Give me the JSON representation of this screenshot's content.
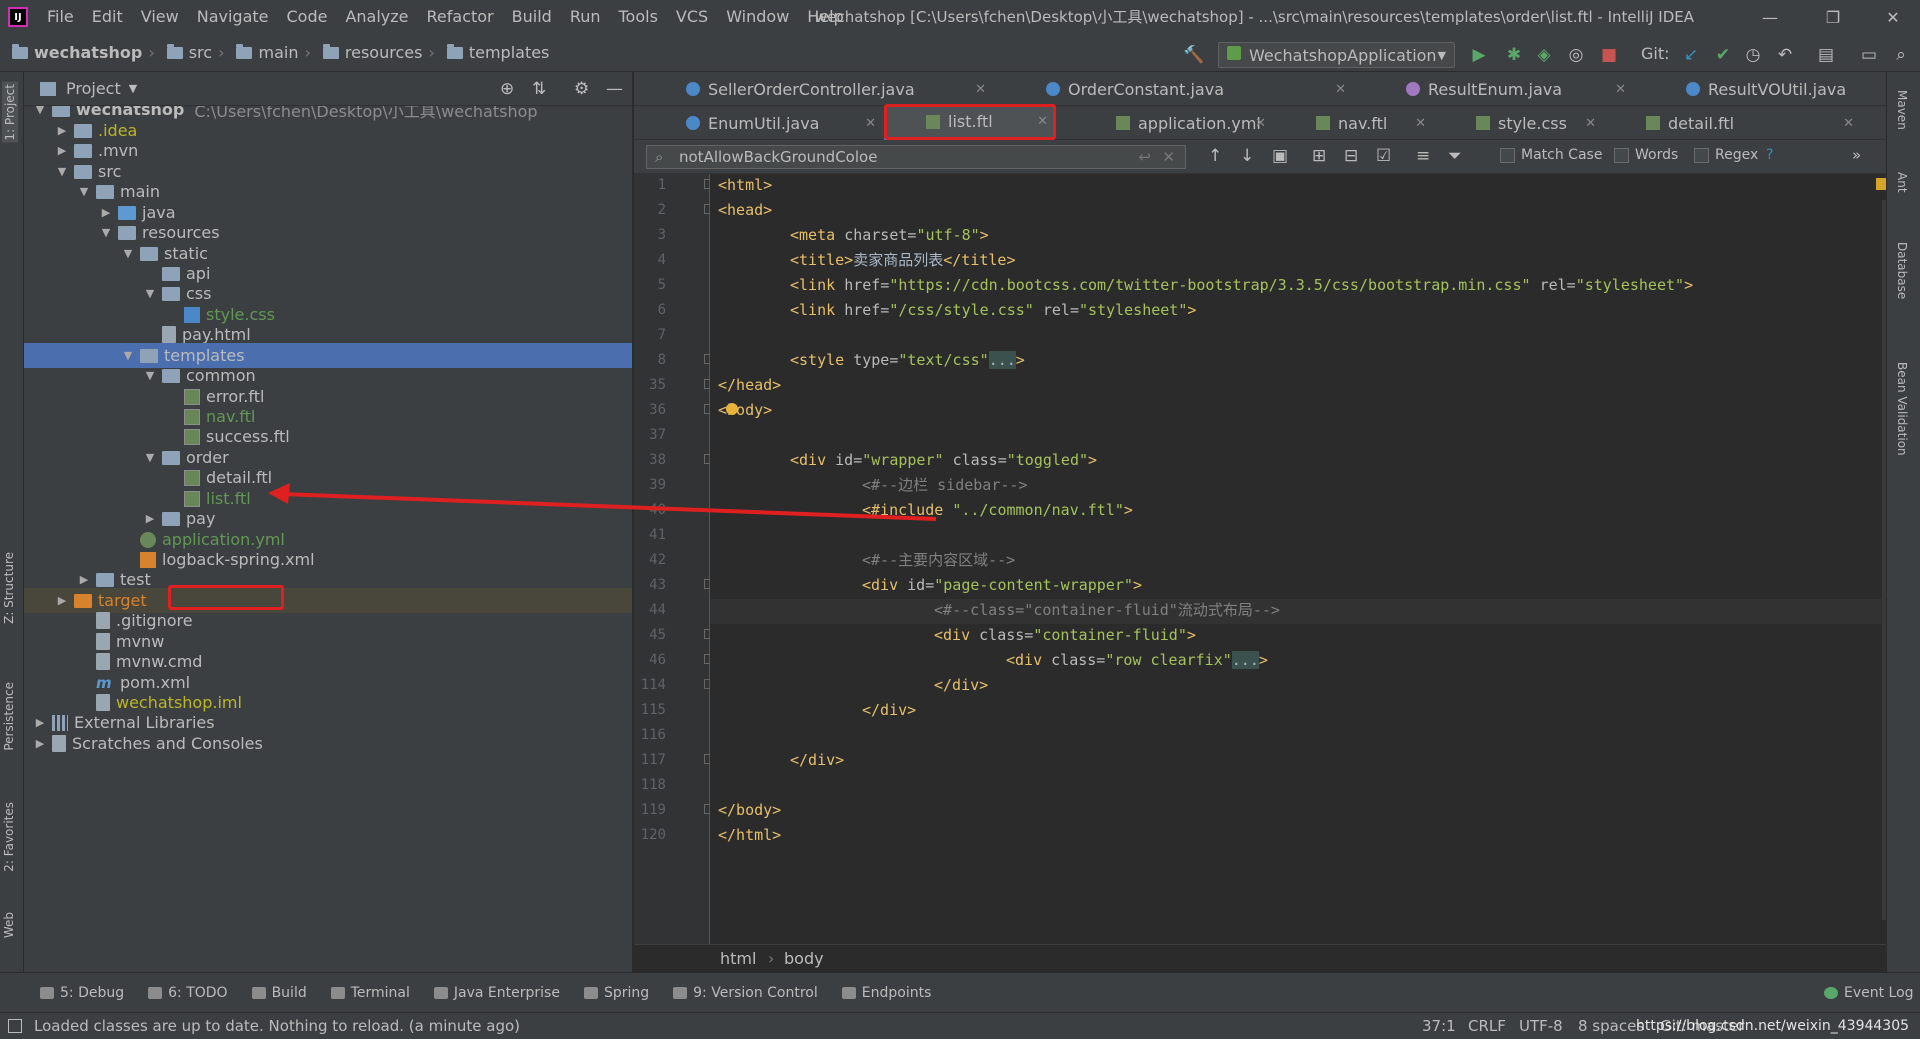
{
  "window": {
    "title": "wechatshop [C:\\Users\\fchen\\Desktop\\小工具\\wechatshop] - ...\\src\\main\\resources\\templates\\order\\list.ftl - IntelliJ IDEA",
    "menu": [
      "File",
      "Edit",
      "View",
      "Navigate",
      "Code",
      "Analyze",
      "Refactor",
      "Build",
      "Run",
      "Tools",
      "VCS",
      "Window",
      "Help"
    ]
  },
  "navbar": {
    "crumbs": [
      "wechatshop",
      "src",
      "main",
      "resources",
      "templates"
    ],
    "run_config": "WechatshopApplication",
    "git_label": "Git:"
  },
  "project": {
    "title": "Project",
    "rows": [
      {
        "label": "wechatshop",
        "extra": "C:\\Users\\fchen\\Desktop\\小工具\\wechatshop",
        "depth": 0,
        "arrow": "▼",
        "icon": "dir",
        "cls": "bold"
      },
      {
        "label": ".idea",
        "depth": 1,
        "arrow": "▶",
        "icon": "dir",
        "cls": "yellow"
      },
      {
        "label": ".mvn",
        "depth": 1,
        "arrow": "▶",
        "icon": "dir"
      },
      {
        "label": "src",
        "depth": 1,
        "arrow": "▼",
        "icon": "dir"
      },
      {
        "label": "main",
        "depth": 2,
        "arrow": "▼",
        "icon": "dir"
      },
      {
        "label": "java",
        "depth": 3,
        "arrow": "▶",
        "icon": "dir blue"
      },
      {
        "label": "resources",
        "depth": 3,
        "arrow": "▼",
        "icon": "dir"
      },
      {
        "label": "static",
        "depth": 4,
        "arrow": "▼",
        "icon": "dir"
      },
      {
        "label": "api",
        "depth": 5,
        "arrow": "",
        "icon": "dir"
      },
      {
        "label": "css",
        "depth": 5,
        "arrow": "▼",
        "icon": "dir"
      },
      {
        "label": "style.css",
        "depth": 6,
        "arrow": "",
        "icon": "css",
        "cls": "green"
      },
      {
        "label": "pay.html",
        "depth": 5,
        "arrow": "",
        "icon": "file"
      },
      {
        "label": "templates",
        "depth": 4,
        "arrow": "▼",
        "icon": "dir",
        "cls": "sel"
      },
      {
        "label": "common",
        "depth": 5,
        "arrow": "▼",
        "icon": "dir"
      },
      {
        "label": "error.ftl",
        "depth": 6,
        "arrow": "",
        "icon": "ftl"
      },
      {
        "label": "nav.ftl",
        "depth": 6,
        "arrow": "",
        "icon": "ftl",
        "cls": "green"
      },
      {
        "label": "success.ftl",
        "depth": 6,
        "arrow": "",
        "icon": "ftl"
      },
      {
        "label": "order",
        "depth": 5,
        "arrow": "▼",
        "icon": "dir"
      },
      {
        "label": "detail.ftl",
        "depth": 6,
        "arrow": "",
        "icon": "ftl"
      },
      {
        "label": "list.ftl",
        "depth": 6,
        "arrow": "",
        "icon": "ftl",
        "cls": "green"
      },
      {
        "label": "pay",
        "depth": 5,
        "arrow": "▶",
        "icon": "dir"
      },
      {
        "label": "application.yml",
        "depth": 4,
        "arrow": "",
        "icon": "yml",
        "cls": "green"
      },
      {
        "label": "logback-spring.xml",
        "depth": 4,
        "arrow": "",
        "icon": "xml"
      },
      {
        "label": "test",
        "depth": 2,
        "arrow": "▶",
        "icon": "dir"
      },
      {
        "label": "target",
        "depth": 1,
        "arrow": "▶",
        "icon": "dir orange",
        "cls": "orangetxt target"
      },
      {
        "label": ".gitignore",
        "depth": 2,
        "arrow": "",
        "icon": "file"
      },
      {
        "label": "mvnw",
        "depth": 2,
        "arrow": "",
        "icon": "file"
      },
      {
        "label": "mvnw.cmd",
        "depth": 2,
        "arrow": "",
        "icon": "file"
      },
      {
        "label": "pom.xml",
        "depth": 2,
        "arrow": "",
        "icon": "m"
      },
      {
        "label": "wechatshop.iml",
        "depth": 2,
        "arrow": "",
        "icon": "file",
        "cls": "yellow"
      },
      {
        "label": "External Libraries",
        "depth": 0,
        "arrow": "▶",
        "icon": "lib"
      },
      {
        "label": "Scratches and Consoles",
        "depth": 0,
        "arrow": "▶",
        "icon": "file"
      }
    ]
  },
  "tabs_row1": [
    "SellerOrderController.java",
    "OrderConstant.java",
    "ResultEnum.java",
    "ResultVOUtil.java"
  ],
  "tabs_row2": [
    "EnumUtil.java",
    "list.ftl",
    "application.yml",
    "nav.ftl",
    "style.css",
    "detail.ftl"
  ],
  "search": {
    "query": "notAllowBackGroundColoe",
    "match_case": "Match Case",
    "words": "Words",
    "regex": "Regex",
    "help": "?"
  },
  "lines": [
    {
      "n": "1",
      "h": "<span class='t'>&lt;html&gt;</span>",
      "i": 0
    },
    {
      "n": "2",
      "h": "<span class='t'>&lt;head&gt;</span>",
      "i": 0
    },
    {
      "n": "3",
      "h": "<span class='t'>&lt;meta </span><span class='a'>charset=</span><span class='v'>\"utf-8\"</span><span class='t'>&gt;</span>",
      "i": 1
    },
    {
      "n": "4",
      "h": "<span class='t'>&lt;title&gt;</span><span class='tx'>卖家商品列表</span><span class='t'>&lt;/title&gt;</span>",
      "i": 1
    },
    {
      "n": "5",
      "h": "<span class='t'>&lt;link </span><span class='a'>href=</span><span class='v'>\"https://cdn.bootcss.com/twitter-bootstrap/3.3.5/css/bootstrap.min.css\" </span><span class='a'>rel=</span><span class='v'>\"stylesheet\"</span><span class='t'>&gt;</span>",
      "i": 1
    },
    {
      "n": "6",
      "h": "<span class='t'>&lt;link </span><span class='a'>href=</span><span class='v'>\"/css/style.css\" </span><span class='a'>rel=</span><span class='v'>\"stylesheet\"</span><span class='t'>&gt;</span>",
      "i": 1
    },
    {
      "n": "7",
      "h": "",
      "i": 0
    },
    {
      "n": "8",
      "h": "<span class='t'>&lt;style </span><span class='a'>type=</span><span class='v'>\"text/css\"</span><span class='fold'>...</span><span class='t'>&gt;</span>",
      "i": 1
    },
    {
      "n": "35",
      "h": "<span class='t'>&lt;/head&gt;</span>",
      "i": 0
    },
    {
      "n": "36",
      "h": "<span class='t'>&lt;body&gt;</span>",
      "i": 0
    },
    {
      "n": "37",
      "h": "",
      "i": 0
    },
    {
      "n": "38",
      "h": "<span class='t'>&lt;div </span><span class='a'>id=</span><span class='v'>\"wrapper\" </span><span class='a'>class=</span><span class='v'>\"toggled\"</span><span class='t'>&gt;</span>",
      "i": 1
    },
    {
      "n": "39",
      "h": "<span class='c'>&lt;#--边栏 sidebar--&gt;</span>",
      "i": 2
    },
    {
      "n": "40",
      "h": "<span class='t'>&lt;#include </span><span class='v'>\"../common/nav.ftl\"</span><span class='t'>&gt;</span>",
      "i": 2
    },
    {
      "n": "41",
      "h": "",
      "i": 0
    },
    {
      "n": "42",
      "h": "<span class='c'>&lt;#--主要内容区域--&gt;</span>",
      "i": 2
    },
    {
      "n": "43",
      "h": "<span class='t'>&lt;div </span><span class='a'>id=</span><span class='v'>\"page-content-wrapper\"</span><span class='t'>&gt;</span>",
      "i": 2
    },
    {
      "n": "44",
      "h": "<span class='c'>&lt;#--class=\"container-fluid\"流动式布局--&gt;</span>",
      "i": 3
    },
    {
      "n": "45",
      "h": "<span class='t'>&lt;div </span><span class='a'>class=</span><span class='v'>\"container-fluid\"</span><span class='t'>&gt;</span>",
      "i": 3
    },
    {
      "n": "46",
      "h": "<span class='t'>&lt;div </span><span class='a'>class=</span><span class='v'>\"row clearfix\"</span><span class='fold'>...</span><span class='t'>&gt;</span>",
      "i": 4
    },
    {
      "n": "114",
      "h": "<span class='t'>&lt;/div&gt;</span>",
      "i": 3
    },
    {
      "n": "115",
      "h": "<span class='t'>&lt;/div&gt;</span>",
      "i": 2
    },
    {
      "n": "116",
      "h": "",
      "i": 0
    },
    {
      "n": "117",
      "h": "<span class='t'>&lt;/div&gt;</span>",
      "i": 1
    },
    {
      "n": "118",
      "h": "",
      "i": 0
    },
    {
      "n": "119",
      "h": "<span class='t'>&lt;/body&gt;</span>",
      "i": 0
    },
    {
      "n": "120",
      "h": "<span class='t'>&lt;/html&gt;</span>",
      "i": 0
    }
  ],
  "breadcrumb": [
    "html",
    "body"
  ],
  "left_strip": [
    "1: Project",
    "Z: Structure",
    "Persistence",
    "2: Favorites",
    "Web"
  ],
  "right_strip": [
    "Maven",
    "Ant",
    "Database",
    "Bean Validation"
  ],
  "toolwindows": [
    "5: Debug",
    "6: TODO",
    "Build",
    "Terminal",
    "Java Enterprise",
    "Spring",
    "9: Version Control",
    "Endpoints"
  ],
  "event_log": "Event Log",
  "status": {
    "message": "Loaded classes are up to date. Nothing to reload. (a minute ago)",
    "pos": "37:1",
    "crlf": "CRLF",
    "enc": "UTF-8",
    "indent": "8 spaces",
    "git": "Git: master",
    "watermark": "https://blog.csdn.net/weixin_43944305"
  }
}
